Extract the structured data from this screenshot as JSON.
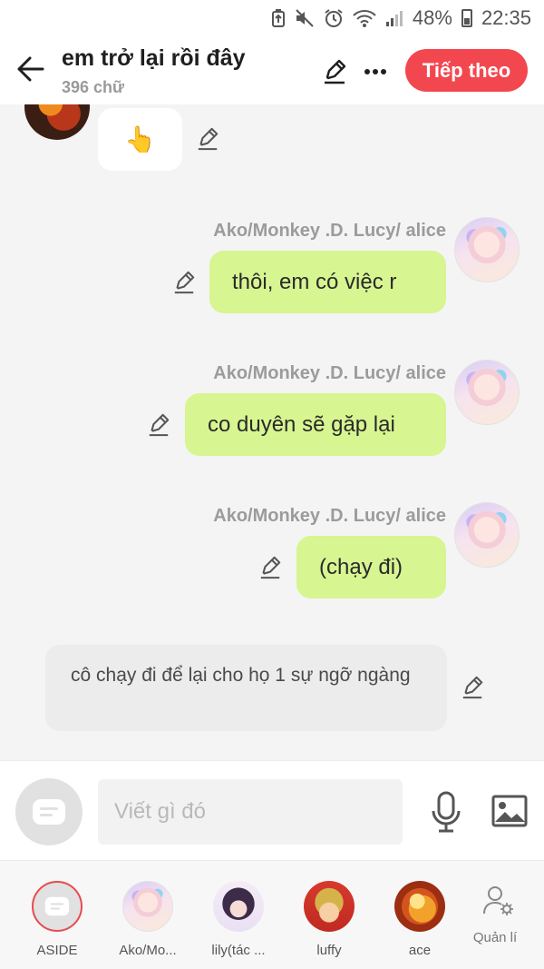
{
  "status_bar": {
    "battery": "48%",
    "time": "22:35"
  },
  "header": {
    "title": "em trở lại rồi đây",
    "word_count": "396 chữ",
    "next_button": "Tiếp theo"
  },
  "messages": [
    {
      "type": "left",
      "content": "👆"
    },
    {
      "type": "right",
      "sender": "Ako/Monkey .D. Lucy/ alice",
      "text": "thôi, em có việc r"
    },
    {
      "type": "right",
      "sender": "Ako/Monkey .D. Lucy/ alice",
      "text": "co duyên sẽ gặp lại"
    },
    {
      "type": "right",
      "sender": "Ako/Monkey .D. Lucy/ alice",
      "text": "(chạy đi)"
    },
    {
      "type": "narration",
      "text": "cô chạy đi để lại cho họ 1 sự ngỡ ngàng"
    }
  ],
  "input": {
    "placeholder": "Viết gì đó"
  },
  "characters": [
    {
      "label": "ASIDE"
    },
    {
      "label": "Ako/Mo..."
    },
    {
      "label": "lily(tác ..."
    },
    {
      "label": "luffy"
    },
    {
      "label": "ace"
    }
  ],
  "manage_label": "Quản lí",
  "colors": {
    "accent": "#f3474f",
    "bubble_green": "#d7f591",
    "narration_bg": "#ececec",
    "chat_bg": "#f4f4f4"
  },
  "icons": [
    "back-arrow-icon",
    "pencil-icon",
    "more-dots-icon",
    "mic-icon",
    "image-icon",
    "aside-chat-icon",
    "manage-user-icon",
    "pointing-up-emoji"
  ]
}
